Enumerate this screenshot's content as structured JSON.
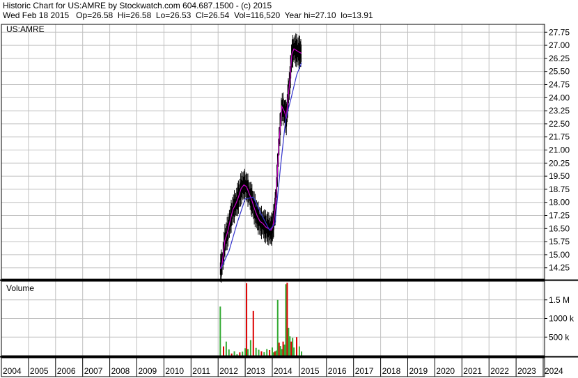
{
  "header": {
    "line1": "Historic Chart for US:AMRE by Stockwatch.com 604.687.1500 - (c) 2015",
    "line2": "Wed Feb 18 2015   Op=26.58  Hi=26.58  Lo=26.53  Cl=26.54  Vol=116,520  Year hi=27.10  lo=13.91"
  },
  "colors": {
    "price_bar": "#000000",
    "ma_short": "#cc00cc",
    "ma_long": "#3333cc",
    "vol_up": "#33aa33",
    "vol_down": "#dd0000",
    "grid": "#c0c0c0"
  },
  "chart_data": [
    {
      "type": "line",
      "title": "US:AMRE",
      "ylim": [
        13.6,
        28.2
      ],
      "y_ticks": [
        "14.25",
        "15.00",
        "15.75",
        "16.50",
        "17.25",
        "18.00",
        "18.75",
        "19.50",
        "20.25",
        "21.00",
        "21.75",
        "22.50",
        "23.25",
        "24.00",
        "24.75",
        "25.50",
        "26.25",
        "27.00",
        "27.75"
      ],
      "x_years": [
        "2004",
        "2005",
        "2006",
        "2007",
        "2008",
        "2009",
        "2010",
        "2011",
        "2012",
        "2013",
        "2014",
        "2015",
        "2016",
        "2017",
        "2018",
        "2019",
        "2020",
        "2021",
        "2022",
        "2023",
        "2024"
      ],
      "series": [
        {
          "x": [
            2012.08,
            2012.15,
            2012.25,
            2012.35,
            2012.45,
            2012.55,
            2012.65,
            2012.75,
            2012.85,
            2012.95,
            2013.05,
            2013.15,
            2013.25,
            2013.35,
            2013.45,
            2013.55,
            2013.65,
            2013.75,
            2013.85,
            2013.95,
            2014.02,
            2014.08,
            2014.12,
            2014.18,
            2014.25,
            2014.35,
            2014.45,
            2014.52,
            2014.58,
            2014.65,
            2014.72,
            2014.8,
            2014.9,
            2015.0,
            2015.08
          ],
          "y": [
            14.2,
            14.5,
            15.8,
            16.3,
            17.0,
            17.6,
            17.9,
            18.3,
            18.8,
            19.0,
            18.9,
            18.5,
            18.1,
            17.6,
            17.2,
            16.9,
            16.8,
            16.6,
            16.5,
            16.4,
            16.6,
            17.3,
            17.8,
            19.5,
            21.5,
            23.5,
            23.2,
            22.8,
            24.0,
            25.0,
            26.5,
            26.8,
            26.7,
            26.6,
            26.54
          ]
        },
        {
          "x": [
            2012.1,
            2012.4,
            2012.7,
            2013.0,
            2013.3,
            2013.6,
            2013.9,
            2014.1,
            2014.3,
            2014.5,
            2014.7,
            2014.9,
            2015.08
          ],
          "y": [
            14.2,
            15.2,
            16.8,
            18.2,
            18.3,
            17.3,
            16.4,
            16.8,
            20.0,
            22.8,
            24.0,
            25.3,
            26.0
          ]
        }
      ]
    },
    {
      "type": "bar",
      "title": "Volume",
      "y_ticks": [
        "500 k",
        "1000 k",
        "1.5 M"
      ],
      "ylim": [
        0,
        2000000
      ],
      "x": [
        2012.08,
        2012.2,
        2012.3,
        2012.4,
        2012.5,
        2012.6,
        2012.7,
        2012.8,
        2012.9,
        2013.0,
        2013.05,
        2013.1,
        2013.2,
        2013.3,
        2013.4,
        2013.5,
        2013.6,
        2013.7,
        2013.8,
        2013.9,
        2014.0,
        2014.05,
        2014.1,
        2014.15,
        2014.2,
        2014.25,
        2014.3,
        2014.35,
        2014.4,
        2014.45,
        2014.5,
        2014.55,
        2014.6,
        2014.65,
        2014.7,
        2014.75,
        2014.8,
        2014.9,
        2015.0,
        2015.08
      ],
      "values": [
        1320000,
        250000,
        380000,
        170000,
        60000,
        120000,
        40000,
        90000,
        110000,
        200000,
        1950000,
        180000,
        420000,
        1200000,
        210000,
        160000,
        120000,
        95000,
        180000,
        150000,
        220000,
        90000,
        120000,
        140000,
        1500000,
        350000,
        260000,
        180000,
        380000,
        300000,
        1920000,
        1960000,
        750000,
        520000,
        380000,
        480000,
        220000,
        500000,
        250000,
        116520
      ]
    }
  ]
}
